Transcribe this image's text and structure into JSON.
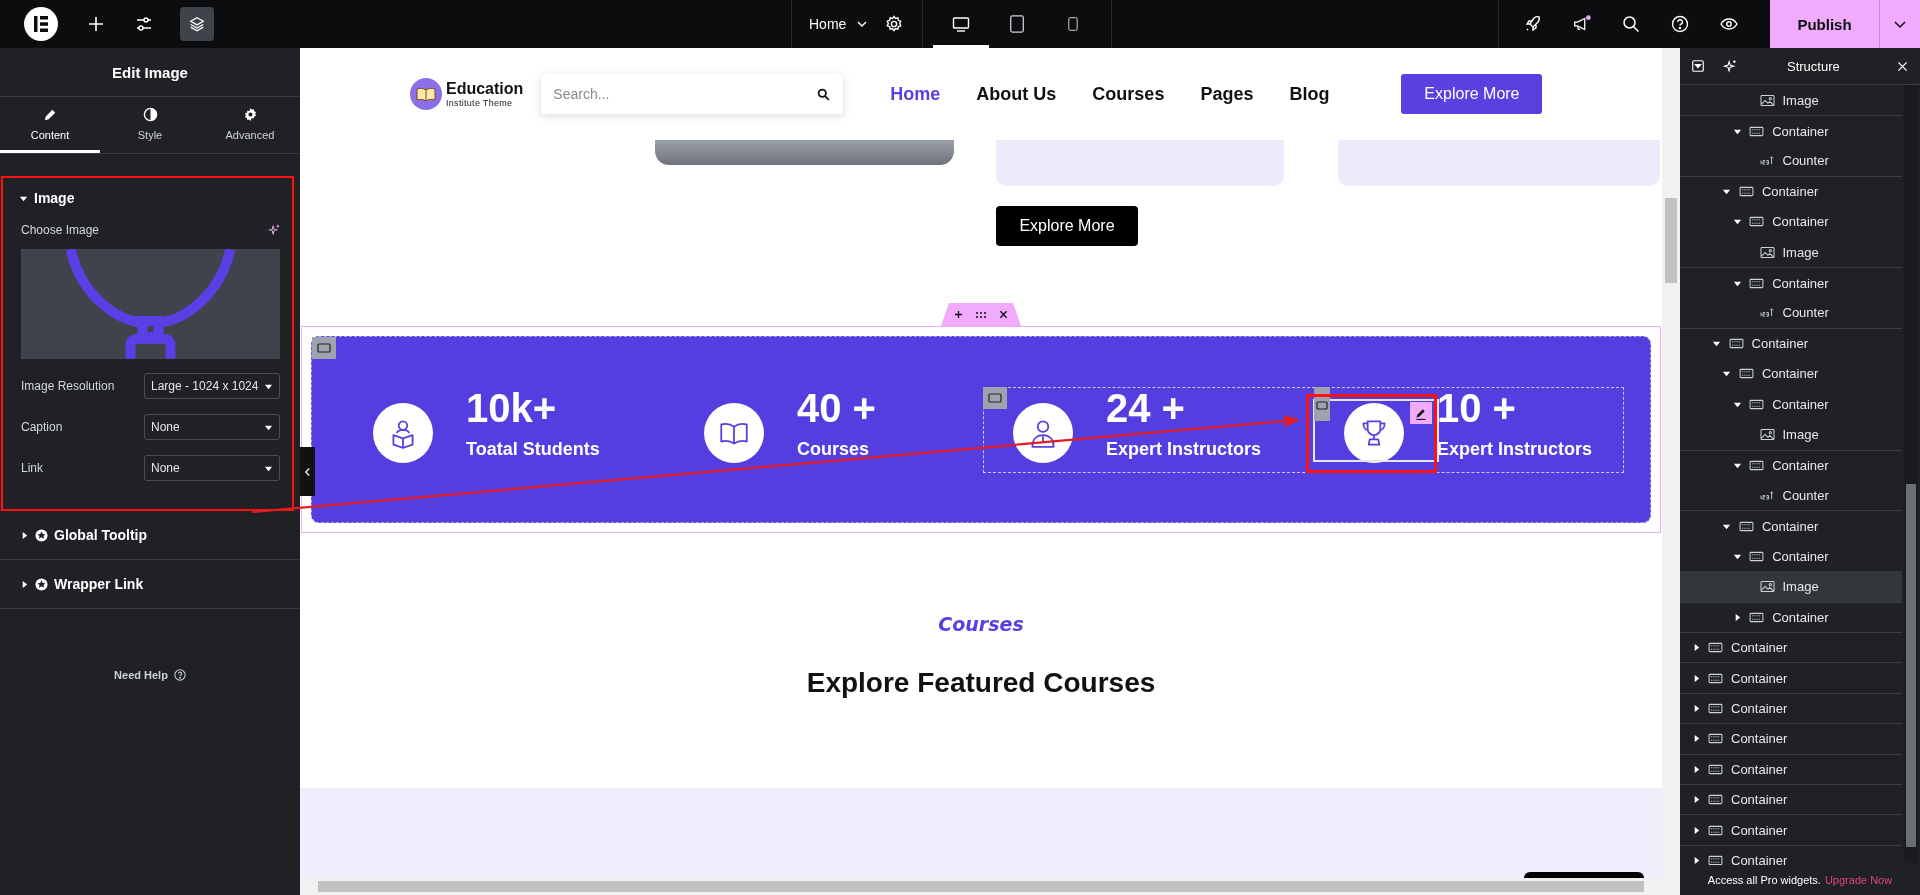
{
  "toolbar": {
    "page": "Home",
    "devices": [
      {
        "kind": "desktop",
        "selected": true
      },
      {
        "kind": "tablet",
        "selected": false
      },
      {
        "kind": "mobile",
        "selected": false
      }
    ],
    "publish": "Publish"
  },
  "panel": {
    "title": "Edit Image",
    "tabs": [
      {
        "kind": "pencil",
        "label": "Content",
        "selected": true
      },
      {
        "kind": "contrast",
        "label": "Style",
        "selected": false
      },
      {
        "kind": "gear",
        "label": "Advanced",
        "selected": false
      }
    ],
    "section": {
      "title": "Image",
      "expanded": true,
      "choose_label": "Choose Image",
      "fields": [
        {
          "label": "Image Resolution",
          "value": "Large - 1024 x 1024"
        },
        {
          "label": "Caption",
          "value": "None"
        },
        {
          "label": "Link",
          "value": "None"
        }
      ]
    },
    "more_sections": [
      {
        "label": "Global Tooltip",
        "expanded": false
      },
      {
        "label": "Wrapper Link",
        "expanded": false
      }
    ],
    "help": "Need Help"
  },
  "site": {
    "logo_title": "Education",
    "logo_subtitle": "Institute Theme",
    "search_placeholder": "Search...",
    "nav": [
      {
        "label": "Home",
        "selected": true
      },
      {
        "label": "About Us",
        "selected": false
      },
      {
        "label": "Courses",
        "selected": false
      },
      {
        "label": "Pages",
        "selected": false
      },
      {
        "label": "Blog",
        "selected": false
      }
    ],
    "cta": "Explore More",
    "secondary_cta": "Explore More",
    "stats": [
      {
        "kind": "reader",
        "value": "10k+",
        "label": "Toatal Students"
      },
      {
        "kind": "book",
        "value": "40 +",
        "label": "Courses"
      },
      {
        "kind": "person",
        "value": "24 +",
        "label": "Expert Instructors"
      },
      {
        "kind": "trophy",
        "value": "10 +",
        "label": "Expert Instructors"
      }
    ],
    "eyebrow": "Courses",
    "heading": "Explore Featured Courses"
  },
  "structure": {
    "title": "Structure",
    "tree": [
      {
        "children": [
          {
            "children": [
              {
                "children": [
                  {
                    "children": [
                      {
                        "children": [
                          {
                            "kind": "image",
                            "label": "Image",
                            "selected": false
                          }
                        ]
                      },
                      {
                        "kind": "container",
                        "label": "Container",
                        "expanded": true,
                        "selected": false,
                        "children": [
                          {
                            "kind": "counter",
                            "label": "Counter",
                            "selected": false
                          }
                        ]
                      }
                    ]
                  },
                  {
                    "kind": "container",
                    "label": "Container",
                    "expanded": true,
                    "selected": false,
                    "children": [
                      {
                        "kind": "container",
                        "label": "Container",
                        "expanded": true,
                        "selected": false,
                        "children": [
                          {
                            "kind": "image",
                            "label": "Image",
                            "selected": false
                          }
                        ]
                      },
                      {
                        "kind": "container",
                        "label": "Container",
                        "expanded": true,
                        "selected": false,
                        "children": [
                          {
                            "kind": "counter",
                            "label": "Counter",
                            "selected": false
                          }
                        ]
                      }
                    ]
                  }
                ]
              },
              {
                "kind": "container",
                "label": "Container",
                "expanded": true,
                "selected": false,
                "children": [
                  {
                    "kind": "container",
                    "label": "Container",
                    "expanded": true,
                    "selected": false,
                    "children": [
                      {
                        "kind": "container",
                        "label": "Container",
                        "expanded": true,
                        "selected": false,
                        "children": [
                          {
                            "kind": "image",
                            "label": "Image",
                            "selected": false
                          }
                        ]
                      },
                      {
                        "kind": "container",
                        "label": "Container",
                        "expanded": true,
                        "selected": false,
                        "children": [
                          {
                            "kind": "counter",
                            "label": "Counter",
                            "selected": false
                          }
                        ]
                      }
                    ]
                  },
                  {
                    "kind": "container",
                    "label": "Container",
                    "expanded": true,
                    "selected": false,
                    "children": [
                      {
                        "kind": "container",
                        "label": "Container",
                        "expanded": true,
                        "selected": false,
                        "children": [
                          {
                            "kind": "image",
                            "label": "Image",
                            "selected": true
                          }
                        ]
                      },
                      {
                        "kind": "container",
                        "label": "Container",
                        "expanded": false,
                        "selected": false
                      }
                    ]
                  }
                ]
              }
            ]
          }
        ]
      },
      {
        "kind": "container",
        "label": "Container",
        "expanded": false,
        "selected": false
      },
      {
        "kind": "container",
        "label": "Container",
        "expanded": false,
        "selected": false
      },
      {
        "kind": "container",
        "label": "Container",
        "expanded": false,
        "selected": false
      },
      {
        "kind": "container",
        "label": "Container",
        "expanded": false,
        "selected": false
      },
      {
        "kind": "container",
        "label": "Container",
        "expanded": false,
        "selected": false
      },
      {
        "kind": "container",
        "label": "Container",
        "expanded": false,
        "selected": false
      },
      {
        "kind": "container",
        "label": "Container",
        "expanded": false,
        "selected": false
      },
      {
        "kind": "container",
        "label": "Container",
        "expanded": false,
        "selected": false
      }
    ],
    "footer": "Access all Pro widgets.",
    "upgrade": "Upgrade Now"
  }
}
